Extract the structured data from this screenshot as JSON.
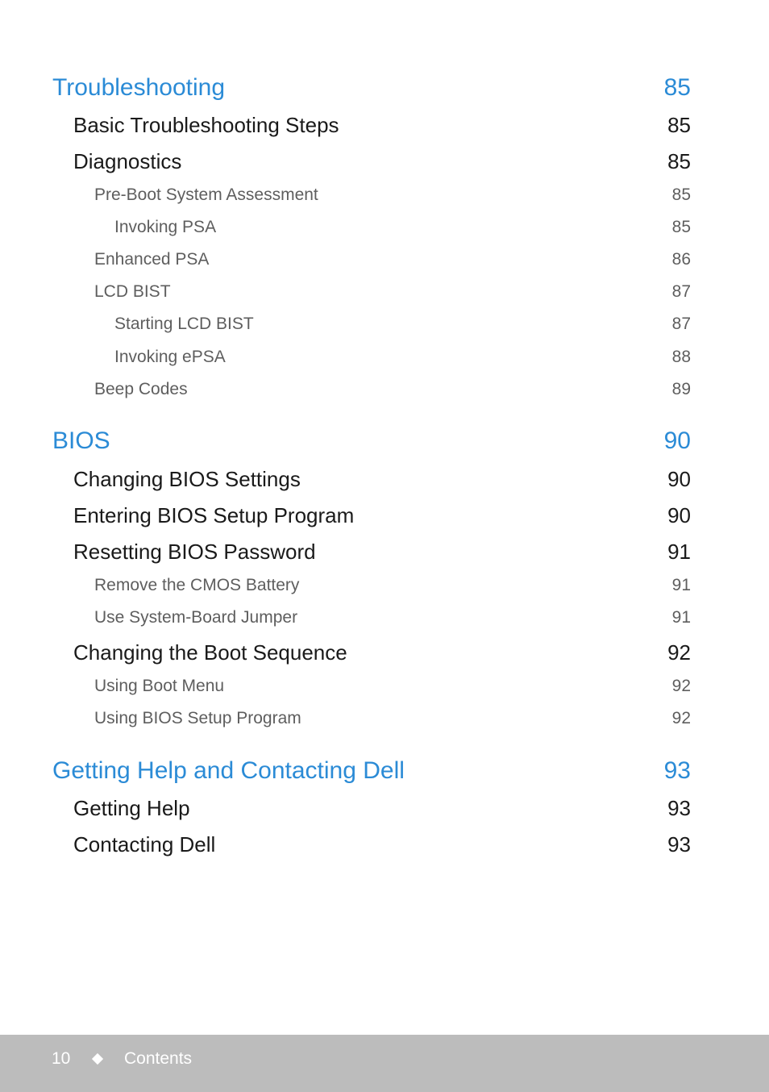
{
  "toc": [
    {
      "level": 0,
      "title": "Troubleshooting",
      "page": "85"
    },
    {
      "level": 1,
      "title": "Basic Troubleshooting Steps",
      "page": "85"
    },
    {
      "level": 1,
      "title": "Diagnostics",
      "page": "85"
    },
    {
      "level": 2,
      "title": "Pre-Boot System Assessment",
      "page": "85"
    },
    {
      "level": 3,
      "title": "Invoking PSA",
      "page": "85"
    },
    {
      "level": 2,
      "title": "Enhanced PSA",
      "page": "86"
    },
    {
      "level": 2,
      "title": "LCD BIST",
      "page": "87"
    },
    {
      "level": 3,
      "title": "Starting LCD BIST",
      "page": "87"
    },
    {
      "level": 3,
      "title": "Invoking ePSA",
      "page": "88"
    },
    {
      "level": 2,
      "title": "Beep Codes",
      "page": "89"
    },
    {
      "level": 0,
      "title": "BIOS",
      "page": "90"
    },
    {
      "level": 1,
      "title": "Changing BIOS Settings",
      "page": "90"
    },
    {
      "level": 1,
      "title": "Entering BIOS Setup Program",
      "page": "90"
    },
    {
      "level": 1,
      "title": "Resetting BIOS Password",
      "page": "91"
    },
    {
      "level": 2,
      "title": "Remove the CMOS Battery",
      "page": "91"
    },
    {
      "level": 2,
      "title": "Use System-Board Jumper",
      "page": "91"
    },
    {
      "level": 1,
      "title": "Changing the Boot Sequence",
      "page": "92"
    },
    {
      "level": 2,
      "title": "Using Boot Menu",
      "page": "92"
    },
    {
      "level": 2,
      "title": "Using BIOS Setup Program",
      "page": "92"
    },
    {
      "level": 0,
      "title": "Getting Help and Contacting Dell",
      "page": "93"
    },
    {
      "level": 1,
      "title": "Getting Help",
      "page": "93"
    },
    {
      "level": 1,
      "title": "Contacting Dell",
      "page": "93"
    }
  ],
  "footer": {
    "page_number": "10",
    "separator_icon": "diamond-icon",
    "section": "Contents"
  },
  "colors": {
    "heading": "#2b8bd6",
    "level1": "#1a1a1a",
    "level2": "#5e5e5e",
    "footer_bg": "#bcbcbc"
  }
}
